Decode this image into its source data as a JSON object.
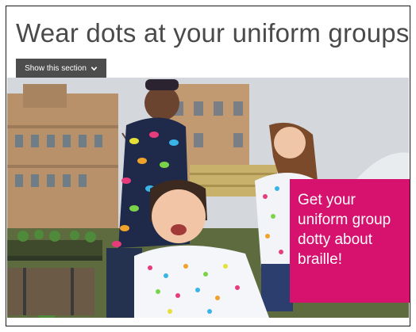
{
  "page": {
    "title": "Wear dots at your uniform groups"
  },
  "section_toggle": {
    "label": "Show this section",
    "icon": "chevron-down-icon"
  },
  "promo": {
    "text": "Get your uniform group dotty about braille!"
  },
  "colors": {
    "promo_background": "#d6126e",
    "button_background": "#4d4d4d",
    "title_text": "#4a4a4a"
  }
}
